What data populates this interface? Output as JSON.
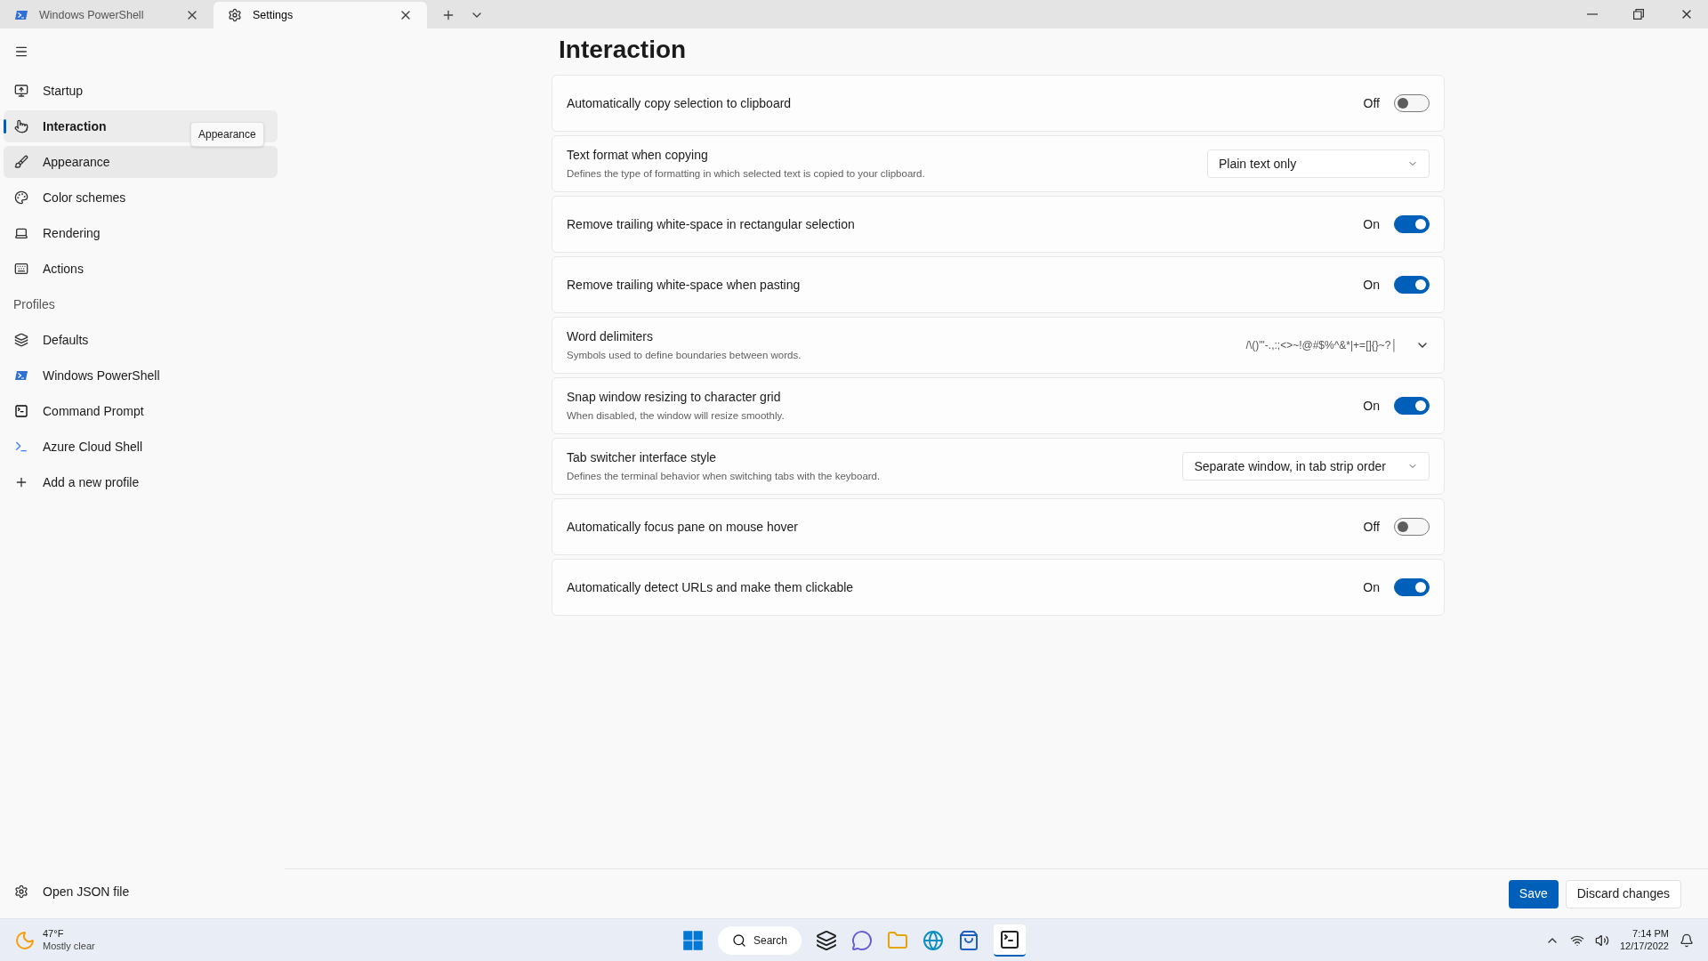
{
  "tabs": [
    {
      "label": "Windows PowerShell",
      "selected": false
    },
    {
      "label": "Settings",
      "selected": true
    }
  ],
  "sidebar": {
    "items": [
      {
        "label": "Startup",
        "selected": false,
        "hovered": false
      },
      {
        "label": "Interaction",
        "selected": true,
        "hovered": false
      },
      {
        "label": "Appearance",
        "selected": false,
        "hovered": true
      },
      {
        "label": "Color schemes",
        "selected": false,
        "hovered": false
      },
      {
        "label": "Rendering",
        "selected": false,
        "hovered": false
      },
      {
        "label": "Actions",
        "selected": false,
        "hovered": false
      }
    ],
    "profiles_heading": "Profiles",
    "profiles": [
      {
        "label": "Defaults",
        "selected": false,
        "hovered": false
      },
      {
        "label": "Windows PowerShell",
        "selected": false,
        "hovered": false
      },
      {
        "label": "Command Prompt",
        "selected": false,
        "hovered": false
      },
      {
        "label": "Azure Cloud Shell",
        "selected": false,
        "hovered": false
      },
      {
        "label": "Add a new profile",
        "selected": false,
        "hovered": false
      }
    ],
    "tooltip": "Appearance",
    "footer": "Open JSON file"
  },
  "page": {
    "title": "Interaction",
    "settings": [
      {
        "kind": "toggle",
        "label": "Automatically copy selection to clipboard",
        "state_text": "Off",
        "on": false
      },
      {
        "kind": "dropdown",
        "label": "Text format when copying",
        "description": "Defines the type of formatting in which selected text is copied to your clipboard.",
        "value": "Plain text only"
      },
      {
        "kind": "toggle",
        "label": "Remove trailing white-space in rectangular selection",
        "state_text": "On",
        "on": true
      },
      {
        "kind": "toggle",
        "label": "Remove trailing white-space when pasting",
        "state_text": "On",
        "on": true
      },
      {
        "kind": "expander",
        "label": "Word delimiters",
        "description": "Symbols used to define boundaries between words.",
        "value": "/\\()\"'-.,:;<>~!@#$%^&*|+=[]{}~?│"
      },
      {
        "kind": "toggle",
        "label": "Snap window resizing to character grid",
        "description": "When disabled, the window will resize smoothly.",
        "state_text": "On",
        "on": true
      },
      {
        "kind": "dropdown",
        "label": "Tab switcher interface style",
        "description": "Defines the terminal behavior when switching tabs with the keyboard.",
        "value": "Separate window, in tab strip order"
      },
      {
        "kind": "toggle",
        "label": "Automatically focus pane on mouse hover",
        "state_text": "Off",
        "on": false
      },
      {
        "kind": "toggle",
        "label": "Automatically detect URLs and make them clickable",
        "state_text": "On",
        "on": true
      }
    ]
  },
  "actions": [
    "Save",
    "Discard changes"
  ],
  "taskbar": {
    "weather": {
      "temp": "47°F",
      "condition": "Mostly clear"
    },
    "search": "Search",
    "time": "7:14 PM",
    "date": "12/17/2022"
  }
}
